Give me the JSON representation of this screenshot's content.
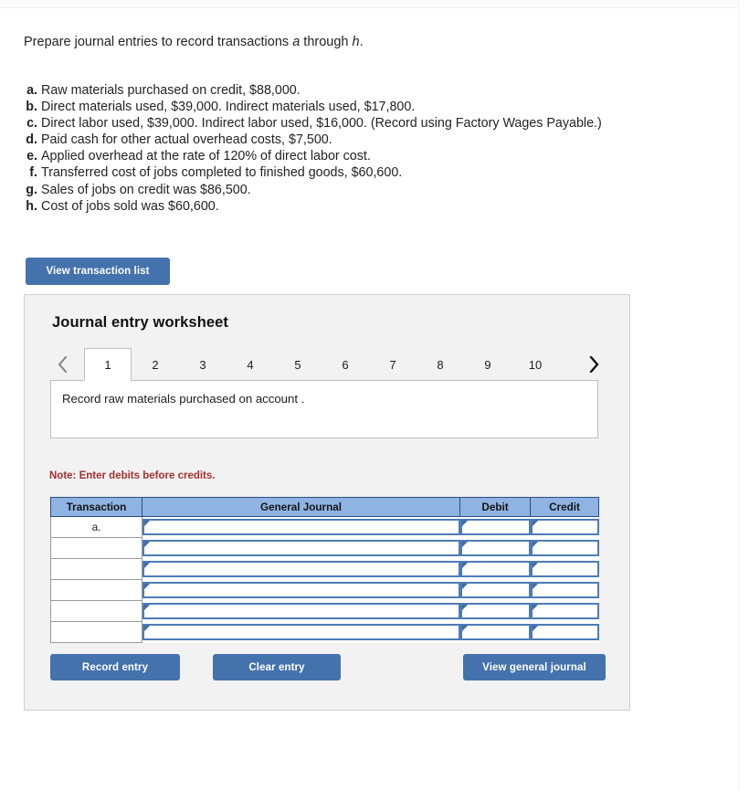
{
  "prompt": {
    "before": "Prepare journal entries to record transactions ",
    "italic_a": "a",
    "middle": " through ",
    "italic_h": "h",
    "after": "."
  },
  "transactions": [
    {
      "key": "a.",
      "text": "Raw materials purchased on credit, $88,000."
    },
    {
      "key": "b.",
      "text": "Direct materials used, $39,000. Indirect materials used, $17,800."
    },
    {
      "key": "c.",
      "text": "Direct labor used, $39,000. Indirect labor used, $16,000. (Record using Factory Wages Payable.)"
    },
    {
      "key": "d.",
      "text": "Paid cash for other actual overhead costs, $7,500."
    },
    {
      "key": "e.",
      "text": "Applied overhead at the rate of 120% of direct labor cost."
    },
    {
      "key": "f.",
      "text": "Transferred cost of jobs completed to finished goods, $60,600."
    },
    {
      "key": "g.",
      "text": "Sales of jobs on credit was $86,500."
    },
    {
      "key": "h.",
      "text": "Cost of jobs sold was $60,600."
    }
  ],
  "buttons": {
    "view_transaction_list": "View transaction list",
    "record_entry": "Record entry",
    "clear_entry": "Clear entry",
    "view_general_journal": "View general journal"
  },
  "worksheet": {
    "title": "Journal entry worksheet",
    "tabs": [
      "1",
      "2",
      "3",
      "4",
      "5",
      "6",
      "7",
      "8",
      "9",
      "10"
    ],
    "active_tab": "1",
    "prev_icon": "chevron-left-icon",
    "next_icon": "chevron-right-icon",
    "instruction": "Record raw materials purchased on account .",
    "note": "Note: Enter debits before credits."
  },
  "table": {
    "headers": [
      "Transaction",
      "General Journal",
      "Debit",
      "Credit"
    ],
    "rows": [
      {
        "transaction": "a.",
        "general_journal": "",
        "debit": "",
        "credit": ""
      },
      {
        "transaction": "",
        "general_journal": "",
        "debit": "",
        "credit": ""
      },
      {
        "transaction": "",
        "general_journal": "",
        "debit": "",
        "credit": ""
      },
      {
        "transaction": "",
        "general_journal": "",
        "debit": "",
        "credit": ""
      },
      {
        "transaction": "",
        "general_journal": "",
        "debit": "",
        "credit": ""
      },
      {
        "transaction": "",
        "general_journal": "",
        "debit": "",
        "credit": ""
      }
    ]
  },
  "colors": {
    "button_blue": "#4472ad",
    "header_blue": "#8fb4e3",
    "header_border": "#2b4d7e",
    "input_border": "#4d7cb5",
    "note_red": "#a53030",
    "panel_gray": "#f2f2f2"
  }
}
